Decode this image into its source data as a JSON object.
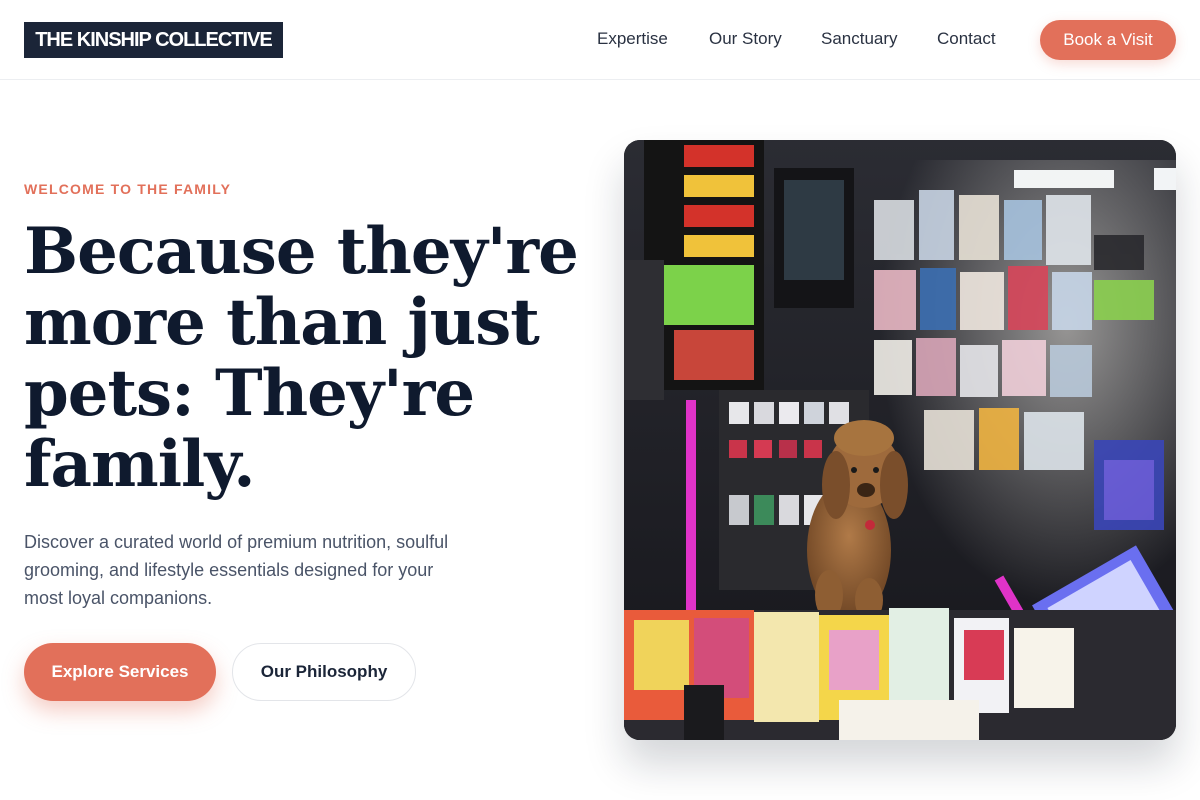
{
  "brand": {
    "name": "THE KINSHIP COLLECTIVE"
  },
  "nav": {
    "items": [
      "Expertise",
      "Our Story",
      "Sanctuary",
      "Contact"
    ],
    "cta_label": "Book a Visit"
  },
  "hero": {
    "eyebrow": "WELCOME TO THE FAMILY",
    "headline": "Because they're more than just pets: They're family.",
    "subtext": "Discover a curated world of premium nutrition, soulful grooming, and lifestyle essentials designed for your most loyal companions.",
    "primary_button": "Explore Services",
    "secondary_button": "Our Philosophy",
    "image_subject": "curly brown poodle sitting on a counter in a colorful convenience shop"
  },
  "colors": {
    "accent": "#e2705a",
    "navy": "#1b2538",
    "heading": "#0f1a2e",
    "body_text": "#4a5468"
  }
}
